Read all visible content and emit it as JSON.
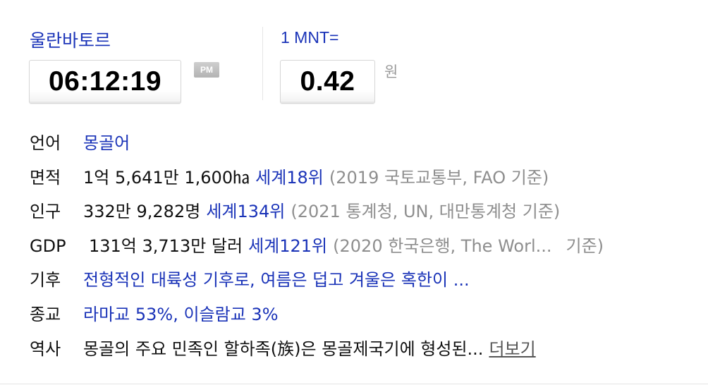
{
  "clock": {
    "city": "울란바토르",
    "time": "06:12:19",
    "ampm": "PM"
  },
  "currency": {
    "unit_label": "1 MNT=",
    "rate": "0.42",
    "target_unit": "원"
  },
  "info": {
    "language": {
      "label": "언어",
      "value": "몽골어"
    },
    "area": {
      "label": "면적",
      "value": "1억 5,641만 1,600㏊",
      "rank": "세계18위",
      "source": "(2019 국토교통부, FAO 기준)"
    },
    "population": {
      "label": "인구",
      "value": "332만 9,282명",
      "rank": "세계134위",
      "source": "(2021 통계청, UN, 대만통계청 기준)"
    },
    "gdp": {
      "label": "GDP",
      "value": "131억 3,713만 달러",
      "rank": "세계121위",
      "source_start": "(2020 한국은행, The Worl...",
      "source_end": "기준)"
    },
    "climate": {
      "label": "기후",
      "value": "전형적인 대륙성 기후로, 여름은 덥고 겨울은 혹한이 ..."
    },
    "religion": {
      "label": "종교",
      "value": "라마교 53%, 이슬람교 3%"
    },
    "history": {
      "label": "역사",
      "value": "몽골의 주요 민족인 할하족(族)은 몽골제국기에 형성된...",
      "more": "더보기"
    }
  }
}
